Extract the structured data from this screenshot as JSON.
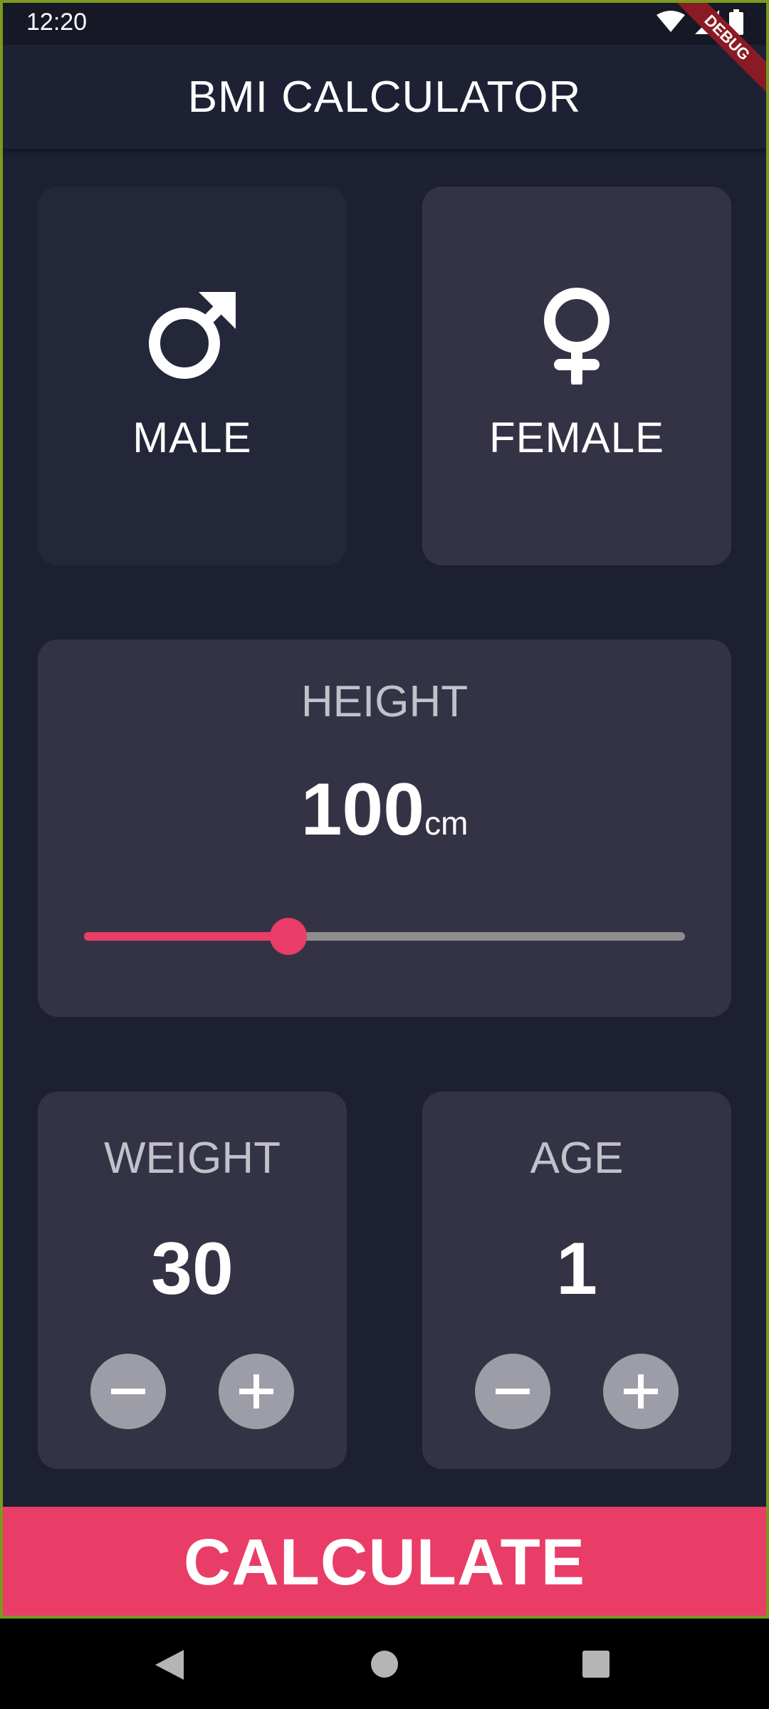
{
  "status_bar": {
    "time": "12:20",
    "icons": [
      "wifi-icon",
      "signal-icon",
      "battery-icon"
    ]
  },
  "app_bar": {
    "title": "BMI CALCULATOR",
    "debug_label": "DEBUG"
  },
  "gender": {
    "male": {
      "label": "MALE",
      "icon": "male-icon",
      "selected": false
    },
    "female": {
      "label": "FEMALE",
      "icon": "female-icon",
      "selected": true
    }
  },
  "height": {
    "label": "HEIGHT",
    "value": "100",
    "unit": "cm",
    "slider_fraction": 0.34
  },
  "weight": {
    "label": "WEIGHT",
    "value": "30",
    "minus_icon": "minus-icon",
    "plus_icon": "plus-icon"
  },
  "age": {
    "label": "AGE",
    "value": "1",
    "minus_icon": "minus-icon",
    "plus_icon": "plus-icon"
  },
  "calculate": {
    "label": "CALCULATE"
  },
  "nav": {
    "back": "back-icon",
    "home": "home-icon",
    "recents": "recents-icon"
  },
  "colors": {
    "background": "#1d2033",
    "card_active": "#343346",
    "card_inactive": "#24263a",
    "accent": "#e93d67",
    "button_round": "#9c9da7"
  }
}
